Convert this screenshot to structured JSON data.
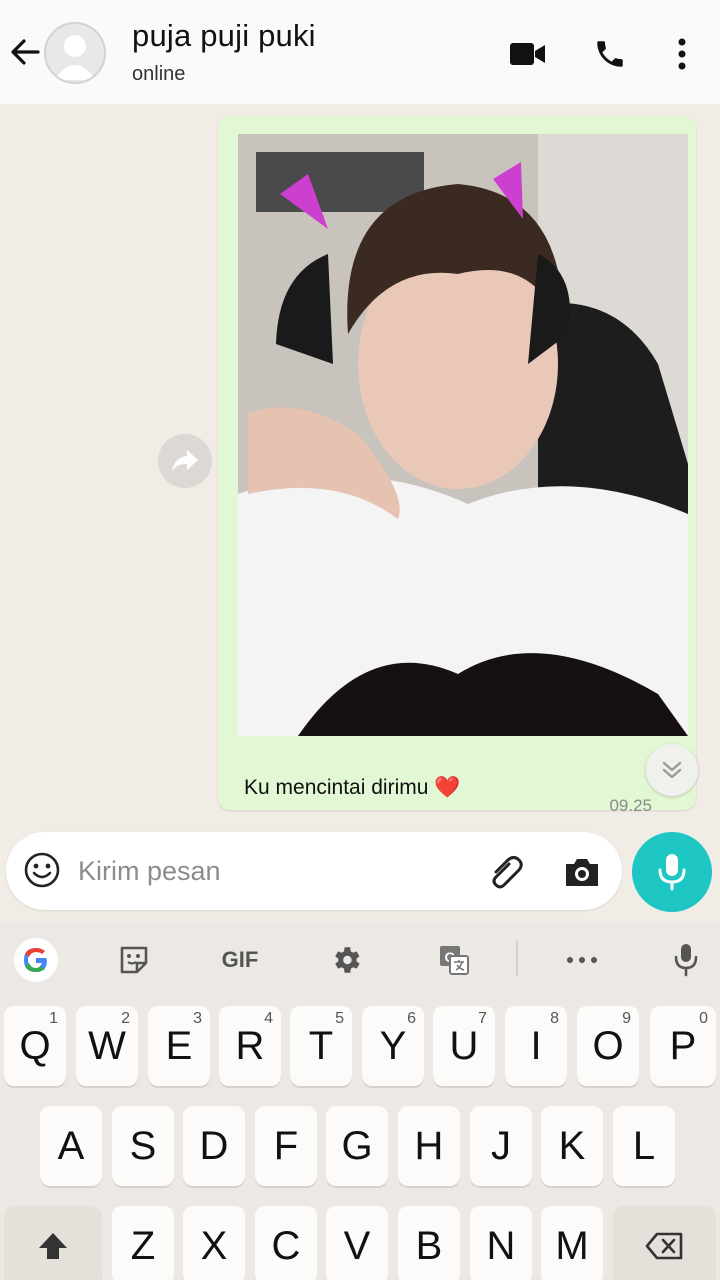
{
  "header": {
    "contact_name": "puja puji puki",
    "status": "online",
    "icons": [
      "back-arrow-icon",
      "avatar",
      "video-call-icon",
      "phone-icon",
      "more-icon"
    ]
  },
  "message": {
    "caption": "Ku mencintai dirimu ❤️",
    "time": "09.25"
  },
  "composer": {
    "placeholder": "Kirim pesan"
  },
  "keyboard": {
    "toolbar": {
      "gif_label": "GIF"
    },
    "row1": [
      {
        "label": "Q",
        "hint": "1"
      },
      {
        "label": "W",
        "hint": "2"
      },
      {
        "label": "E",
        "hint": "3"
      },
      {
        "label": "R",
        "hint": "4"
      },
      {
        "label": "T",
        "hint": "5"
      },
      {
        "label": "Y",
        "hint": "6"
      },
      {
        "label": "U",
        "hint": "7"
      },
      {
        "label": "I",
        "hint": "8"
      },
      {
        "label": "O",
        "hint": "9"
      },
      {
        "label": "P",
        "hint": "0"
      }
    ],
    "row2": [
      "A",
      "S",
      "D",
      "F",
      "G",
      "H",
      "J",
      "K",
      "L"
    ],
    "row3": [
      "Z",
      "X",
      "C",
      "V",
      "B",
      "N",
      "M"
    ]
  }
}
